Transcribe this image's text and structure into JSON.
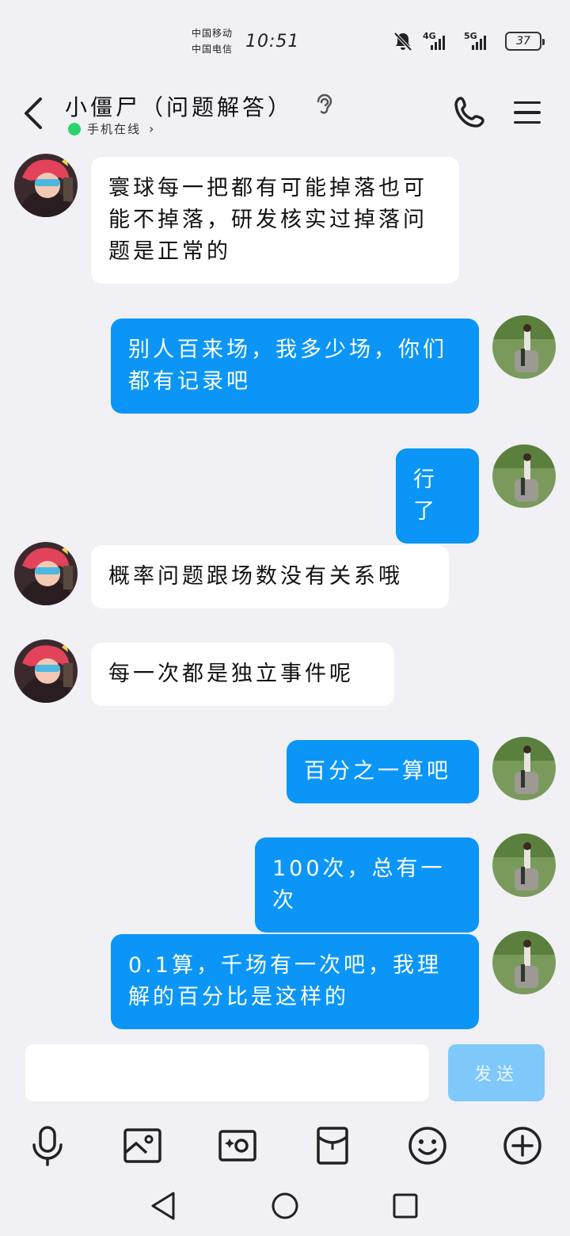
{
  "status_bar": {
    "carrier_1": "中国移动",
    "carrier_2": "中国电信",
    "time": "10:51",
    "net_1": "4G",
    "net_2": "5G",
    "battery": "37"
  },
  "header": {
    "title": "小僵尸（问题解答）",
    "status": "手机在线",
    "status_color": "#2bd46a"
  },
  "messages": [
    {
      "side": "left",
      "text": "寰球每一把都有可能掉落也可能不掉落，研发核实过掉落问题是正常的"
    },
    {
      "side": "right",
      "text": "别人百来场，我多少场，你们都有记录吧"
    },
    {
      "side": "right",
      "text": "行了"
    },
    {
      "side": "left",
      "text": "概率问题跟场数没有关系哦"
    },
    {
      "side": "left",
      "text": "每一次都是独立事件呢"
    },
    {
      "side": "right",
      "text": "百分之一算吧"
    },
    {
      "side": "right",
      "text": "100次，总有一次"
    },
    {
      "side": "right",
      "text": "0.1算，千场有一次吧，我理解的百分比是这样的"
    }
  ],
  "composer": {
    "input_value": "",
    "send_label": "发送"
  },
  "toolbar": {
    "icons": [
      "microphone-icon",
      "image-icon",
      "camera-icon",
      "red-packet-icon",
      "emoji-icon",
      "plus-icon"
    ]
  },
  "colors": {
    "bubble_right": "#0b96f7",
    "bubble_left": "#ffffff",
    "background": "#f0f0f5",
    "send_disabled": "#7fc8fa"
  }
}
